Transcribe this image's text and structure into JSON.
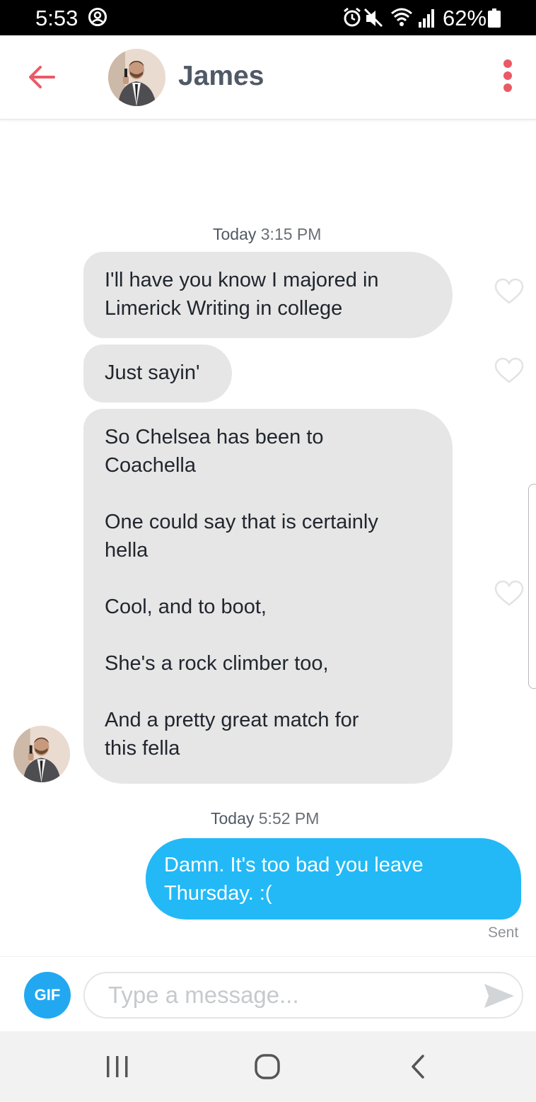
{
  "status_bar": {
    "time": "5:53",
    "battery": "62%"
  },
  "header": {
    "contact_name": "James",
    "accent": "#ea5a65"
  },
  "conversation": [
    {
      "stamp_day": "Today",
      "stamp_time": "3:15 PM",
      "messages": [
        {
          "text": "I'll have you know I majored in\nLimerick Writing in college"
        },
        {
          "text": "Just sayin'"
        },
        {
          "text": "So Chelsea has been to\nCoachella\n\nOne could say that is certainly\nhella\n\nCool, and to boot,\n\nShe's a rock climber too,\n\nAnd a pretty great match for\nthis fella"
        }
      ]
    },
    {
      "stamp_day": "Today",
      "stamp_time": "5:52 PM",
      "messages": [
        {
          "text": "Damn. It's too bad you leave\nThursday. :(",
          "status": "Sent"
        }
      ]
    }
  ],
  "composer": {
    "gif_label": "GIF",
    "placeholder": "Type a message...",
    "gif_color": "#22a8f1"
  },
  "colors": {
    "incoming_bubble": "#e6e6e6",
    "outgoing_bubble": "#22b9f6"
  },
  "icons": [
    "back-arrow-icon",
    "more-options-icon",
    "heart-icon",
    "send-icon",
    "recent-apps-icon",
    "home-icon",
    "nav-back-icon"
  ]
}
